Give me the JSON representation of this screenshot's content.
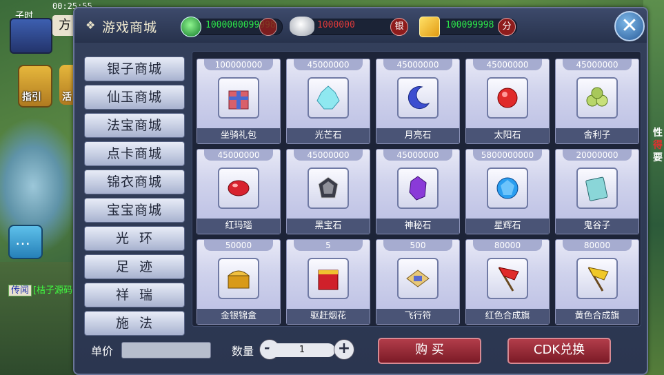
{
  "hud": {
    "time_tag": "子时",
    "clock": "00:25:55",
    "avatar_badge": "方",
    "guide_label": "指引",
    "activity_label": "活",
    "chat_icon": "chat-bubble-icon",
    "msg_tag": "传闻",
    "msg_text": "[桔子源码",
    "right_line1": "性",
    "right_line2": "得",
    "right_line3": "要"
  },
  "shop": {
    "title": "游戏商城",
    "title_icon": "gift-icon",
    "currencies": [
      {
        "icon": "jade-icon",
        "value": "1000000099998",
        "unit": "",
        "color": "#2ce84a"
      },
      {
        "icon": "silver-ingot-icon",
        "value": "1000000",
        "unit": "银",
        "color": "#e03a3a"
      },
      {
        "icon": "card-point-icon",
        "value": "100099998",
        "unit": "分",
        "color": "#2ce84a"
      }
    ],
    "close_icon": "close-icon",
    "categories": [
      "银子商城",
      "仙玉商城",
      "法宝商城",
      "点卡商城",
      "锦衣商城",
      "宝宝商城",
      "光  环",
      "足  迹",
      "祥  瑞",
      "施  法"
    ],
    "items": [
      {
        "price": "100000000",
        "name": "坐骑礼包",
        "icon": "gift-box-icon"
      },
      {
        "price": "45000000",
        "name": "光芒石",
        "icon": "crystal-icon"
      },
      {
        "price": "45000000",
        "name": "月亮石",
        "icon": "moon-stone-icon"
      },
      {
        "price": "45000000",
        "name": "太阳石",
        "icon": "sun-stone-icon"
      },
      {
        "price": "45000000",
        "name": "舍利子",
        "icon": "relic-icon"
      },
      {
        "price": "45000000",
        "name": "红玛瑙",
        "icon": "red-agate-icon"
      },
      {
        "price": "45000000",
        "name": "黑宝石",
        "icon": "black-gem-icon"
      },
      {
        "price": "45000000",
        "name": "神秘石",
        "icon": "mystery-stone-icon"
      },
      {
        "price": "5800000000",
        "name": "星辉石",
        "icon": "star-stone-icon"
      },
      {
        "price": "20000000",
        "name": "鬼谷子",
        "icon": "book-icon"
      },
      {
        "price": "50000",
        "name": "金银锦盒",
        "icon": "treasure-chest-icon"
      },
      {
        "price": "5",
        "name": "驱赶烟花",
        "icon": "firework-icon"
      },
      {
        "price": "500",
        "name": "飞行符",
        "icon": "flight-charm-icon"
      },
      {
        "price": "80000",
        "name": "红色合成旗",
        "icon": "red-flag-icon"
      },
      {
        "price": "80000",
        "name": "黄色合成旗",
        "icon": "yellow-flag-icon"
      }
    ],
    "unit_price_label": "单价",
    "unit_price_value": "",
    "qty_label": "数量",
    "qty_value": "1",
    "minus_icon": "minus-icon",
    "plus_icon": "plus-icon",
    "buy_label": "购 买",
    "cdk_label": "CDK兑换"
  }
}
